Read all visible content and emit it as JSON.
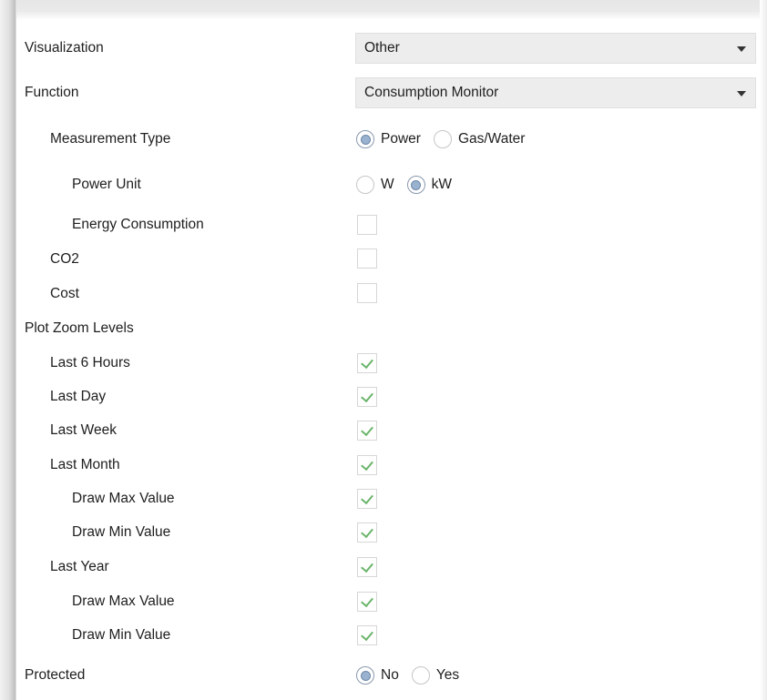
{
  "visualization": {
    "label": "Visualization",
    "value": "Other"
  },
  "function": {
    "label": "Function",
    "value": "Consumption Monitor"
  },
  "measurement_type": {
    "label": "Measurement Type",
    "options": [
      {
        "label": "Power",
        "selected": true
      },
      {
        "label": "Gas/Water",
        "selected": false
      }
    ]
  },
  "power_unit": {
    "label": "Power Unit",
    "options": [
      {
        "label": "W",
        "selected": false
      },
      {
        "label": "kW",
        "selected": true
      }
    ]
  },
  "energy_consumption": {
    "label": "Energy Consumption",
    "checked": false
  },
  "co2": {
    "label": "CO2",
    "checked": false
  },
  "cost": {
    "label": "Cost",
    "checked": false
  },
  "plot_zoom": {
    "label": "Plot Zoom Levels",
    "items": [
      {
        "label": "Last 6 Hours",
        "checked": true
      },
      {
        "label": "Last Day",
        "checked": true
      },
      {
        "label": "Last Week",
        "checked": true
      },
      {
        "label": "Last Month",
        "checked": true
      },
      {
        "label": "Draw Max Value",
        "checked": true
      },
      {
        "label": "Draw Min Value",
        "checked": true
      },
      {
        "label": "Last Year",
        "checked": true
      },
      {
        "label": "Draw Max Value",
        "checked": true
      },
      {
        "label": "Draw Min Value",
        "checked": true
      }
    ]
  },
  "protected": {
    "label": "Protected",
    "options": [
      {
        "label": "No",
        "selected": true
      },
      {
        "label": "Yes",
        "selected": false
      }
    ]
  },
  "colors": {
    "checkmark": "#6ab46a",
    "radio_selected": "#98b2cf",
    "dropdown_bg": "#ededed"
  },
  "icons": {
    "dropdown": "chevron-down-icon",
    "check": "checkmark-icon"
  }
}
